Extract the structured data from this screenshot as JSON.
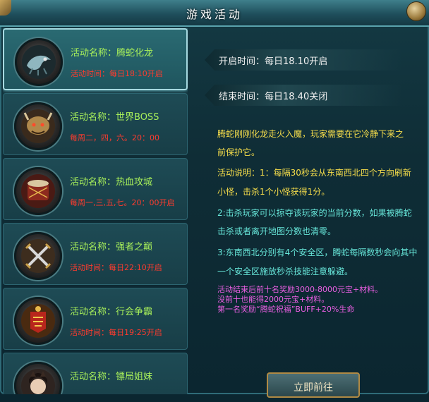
{
  "window": {
    "title": "游戏活动"
  },
  "activities": [
    {
      "name": "活动名称：腾蛇化龙",
      "time": "活动时间：每日18:10开启",
      "selected": true,
      "icon": "serpent-dragon-icon"
    },
    {
      "name": "活动名称：世界BOSS",
      "time": "每周二，四，六。20：00",
      "selected": false,
      "icon": "world-boss-icon"
    },
    {
      "name": "活动名称：热血攻城",
      "time": "每周一,三,五,七。20：00开启",
      "selected": false,
      "icon": "siege-drum-icon"
    },
    {
      "name": "活动名称：强者之巅",
      "time": "活动时间：每日22:10开启",
      "selected": false,
      "icon": "crossed-swords-icon"
    },
    {
      "name": "活动名称：行会争霸",
      "time": "活动时间：每日19:25开启",
      "selected": false,
      "icon": "guild-war-icon"
    },
    {
      "name": "活动名称：镖局姐妹",
      "time": "",
      "selected": false,
      "icon": "escort-sisters-icon"
    }
  ],
  "detail": {
    "open_time": "开启时间：每日18.10开启",
    "close_time": "结束时间：每日18.40关闭",
    "intro_line1": "腾蛇刚刚化龙走火入魔，玩家需要在它冷静下来之",
    "intro_line2": "前保护它。",
    "rule1_line1": "活动说明：1：每隔30秒会从东南西北四个方向刷新",
    "rule1_line2": "小怪，击杀1个小怪获得1分。",
    "rule2_line1": "2:击杀玩家可以掠夺该玩家的当前分数，如果被腾蛇",
    "rule2_line2": "击杀或者离开地图分数也清零。",
    "rule3_line1": "3:东南西北分别有4个安全区，腾蛇每隔数秒会向其中",
    "rule3_line2": "一个安全区施放秒杀技能注意躲避。",
    "reward1": "活动结束后前十名奖励3000-8000元宝+材料。",
    "reward2": "没前十也能得2000元宝+材料。",
    "reward3": "第一名奖励“腾蛇祝福”BUFF+20%生命",
    "go_button": "立即前往"
  },
  "colors": {
    "name_green": "#a8f05a",
    "time_red": "#ff3b2e",
    "text_yellow": "#f7de4b",
    "text_cyan": "#67e6d9",
    "text_pink": "#ec5fe4"
  }
}
